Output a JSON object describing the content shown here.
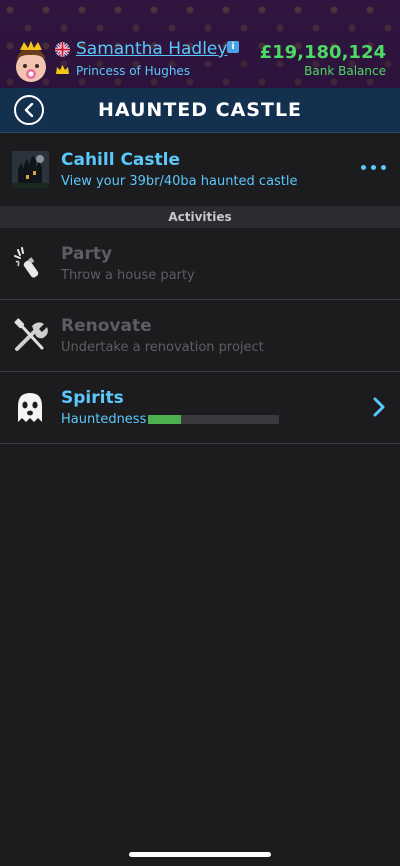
{
  "header": {
    "name": "Samantha Hadley",
    "title": "Princess of Hughes",
    "balance": "£19,180,124",
    "balance_label": "Bank Balance"
  },
  "nav": {
    "title": "HAUNTED CASTLE"
  },
  "property": {
    "title": "Cahill Castle",
    "subtitle": "View your 39br/40ba haunted castle"
  },
  "section": {
    "label": "Activities"
  },
  "activities": [
    {
      "title": "Party",
      "subtitle": "Throw a house party",
      "icon": "party-popper-icon",
      "enabled": false
    },
    {
      "title": "Renovate",
      "subtitle": "Undertake a renovation project",
      "icon": "tools-icon",
      "enabled": false
    },
    {
      "title": "Spirits",
      "subtitle": "Hauntedness",
      "icon": "ghost-icon",
      "enabled": true,
      "meter_fraction": 0.25
    }
  ],
  "colors": {
    "accent": "#5ac8fa",
    "money": "#4cd964",
    "meter": "#4caf50"
  }
}
